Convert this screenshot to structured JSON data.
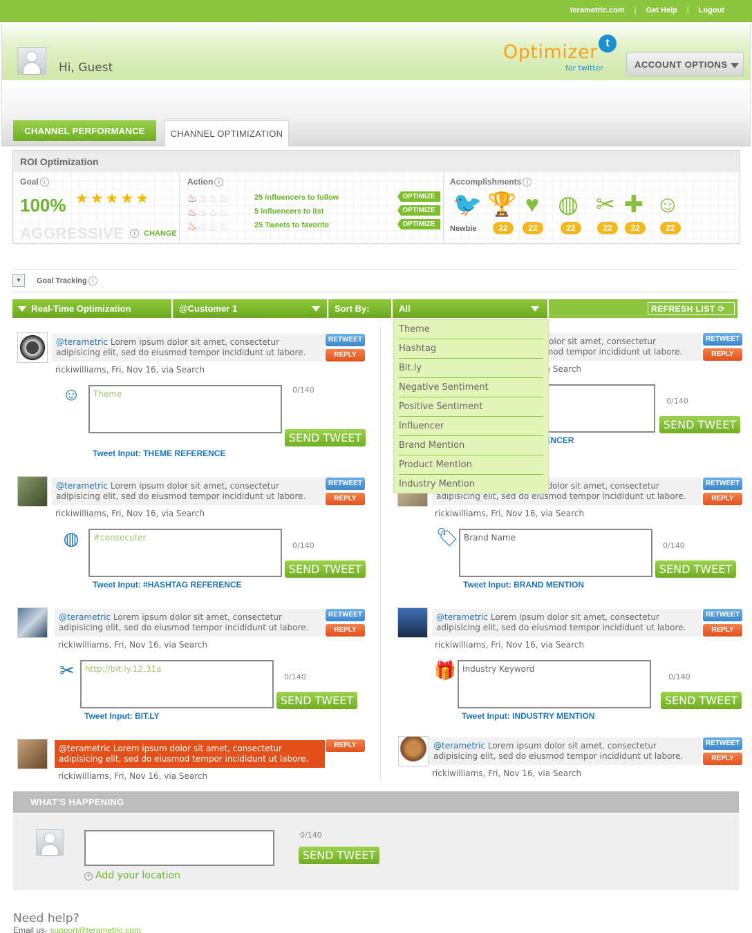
{
  "top_links": [
    "terametric.com",
    "Get Help",
    "Logout"
  ],
  "greeting": "Hi, Guest",
  "logo": {
    "name": "Optimizer",
    "sub": "for twitter",
    "badge": "t"
  },
  "account_options": "ACCOUNT OPTIONS",
  "tabs": [
    {
      "label": "CHANNEL PERFORMANCE",
      "active": false
    },
    {
      "label": "CHANNEL OPTIMIZATION",
      "active": true
    }
  ],
  "roi": {
    "title": "ROI Optimization",
    "goal": {
      "label": "Goal",
      "percent": "100%",
      "stars": 5,
      "level": "AGGRESSIVE",
      "change": "CHANGE"
    },
    "action": {
      "label": "Action",
      "items": [
        {
          "text": "25 influencers to follow",
          "button": "OPTIMIZE",
          "hot": 1
        },
        {
          "text": "5 influencers to list",
          "button": "OPTIMIZE",
          "hot": 1
        },
        {
          "text": "25 Tweets to favorite",
          "button": "OPTIMIZE",
          "hot": 1
        }
      ]
    },
    "accomplishments": {
      "label": "Accomplishments",
      "first_label": "Newbie",
      "badges": [
        {
          "icon": "bird-icon",
          "count": null
        },
        {
          "icon": "trophy-icon",
          "count": "22"
        },
        {
          "icon": "heart-plus-icon",
          "count": "22"
        },
        {
          "icon": "globe-icon",
          "count": "22"
        },
        {
          "icon": "scissors-icon",
          "count": "22"
        },
        {
          "icon": "signpost-icon",
          "count": "22"
        },
        {
          "icon": "theater-masks-icon",
          "count": "22"
        }
      ]
    }
  },
  "goal_tracking": "Goal Tracking",
  "rt_bar": {
    "title": "Real-Time Optimization",
    "account": "@Customer 1",
    "sort_label": "Sort By:",
    "sort_value": "All",
    "refresh": "REFRESH LIST"
  },
  "sort_options": [
    "Theme",
    "Hashtag",
    "Bit.ly",
    "Negative Sentiment",
    "Positive Sentiment",
    "Influencer",
    "Brand Mention",
    "Product Mention",
    "Industry Mention"
  ],
  "tweet_common": {
    "handle": "@terametric",
    "text": " Lorem ipsum dolor sit amet, consectetur adipisicing elit, sed do eiusmod tempor incididunt ut labore.",
    "meta": "rickiwilliams, Fri, Nov 16, via Search",
    "retweet": "RETWEET",
    "reply": "REPLY",
    "count": "0/140",
    "send": "SEND TWEET"
  },
  "tweets": [
    {
      "input": "Theme",
      "label": "Tweet Input: THEME REFERENCE",
      "icon": "theater-masks-icon"
    },
    {
      "input": "",
      "label": "Tweet Input: INFLUENCER",
      "icon": "star-icon"
    },
    {
      "input": "#consecuter",
      "label": "Tweet Input: #HASHTAG REFERENCE",
      "icon": "globe-icon"
    },
    {
      "input": "Brand Name",
      "label": "Tweet Input: BRAND MENTION",
      "icon": "tag-icon"
    },
    {
      "input": "http://bit.ly.12.31a",
      "label": "Tweet Input: BIT.LY",
      "icon": "scissors-icon"
    },
    {
      "input": "Industry Keyword",
      "label": "Tweet Input: INDUSTRY MENTION",
      "icon": "gift-icon"
    }
  ],
  "whats_happening": {
    "title": "WHAT'S HAPPENING",
    "count": "0/140",
    "send": "SEND TWEET",
    "location": "Add your location"
  },
  "footer": {
    "help": "Need help?",
    "email_label": "Email us-",
    "email": "support@terametric.com"
  }
}
